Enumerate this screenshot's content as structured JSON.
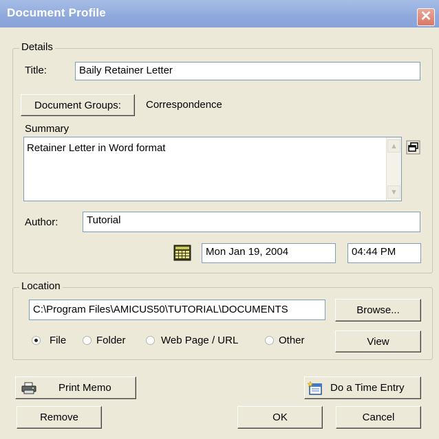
{
  "window": {
    "title": "Document Profile",
    "close_glyph": "✕"
  },
  "details": {
    "legend": "Details",
    "title_label": "Title:",
    "title_value": "Baily Retainer Letter",
    "doc_groups_button": "Document Groups:",
    "doc_groups_value": "Correspondence",
    "summary_label": "Summary",
    "summary_value": "Retainer Letter in Word format",
    "author_label": "Author:",
    "author_value": "Tutorial",
    "date_value": "Mon Jan 19, 2004",
    "time_value": "04:44 PM"
  },
  "location": {
    "legend": "Location",
    "path_value": "C:\\Program Files\\AMICUS50\\TUTORIAL\\DOCUMENTS",
    "browse_button": "Browse...",
    "view_button": "View",
    "types": [
      {
        "label": "File",
        "selected": true
      },
      {
        "label": "Folder",
        "selected": false
      },
      {
        "label": "Web Page / URL",
        "selected": false
      },
      {
        "label": "Other",
        "selected": false
      }
    ]
  },
  "footer": {
    "print_memo_button": "Print Memo",
    "time_entry_button": "Do a Time Entry",
    "remove_button": "Remove",
    "ok_button": "OK",
    "cancel_button": "Cancel"
  },
  "icons": {
    "printer": "printer-icon",
    "calendar": "calendar-icon",
    "expand": "expand-window-icon",
    "time_entry": "time-entry-icon"
  }
}
